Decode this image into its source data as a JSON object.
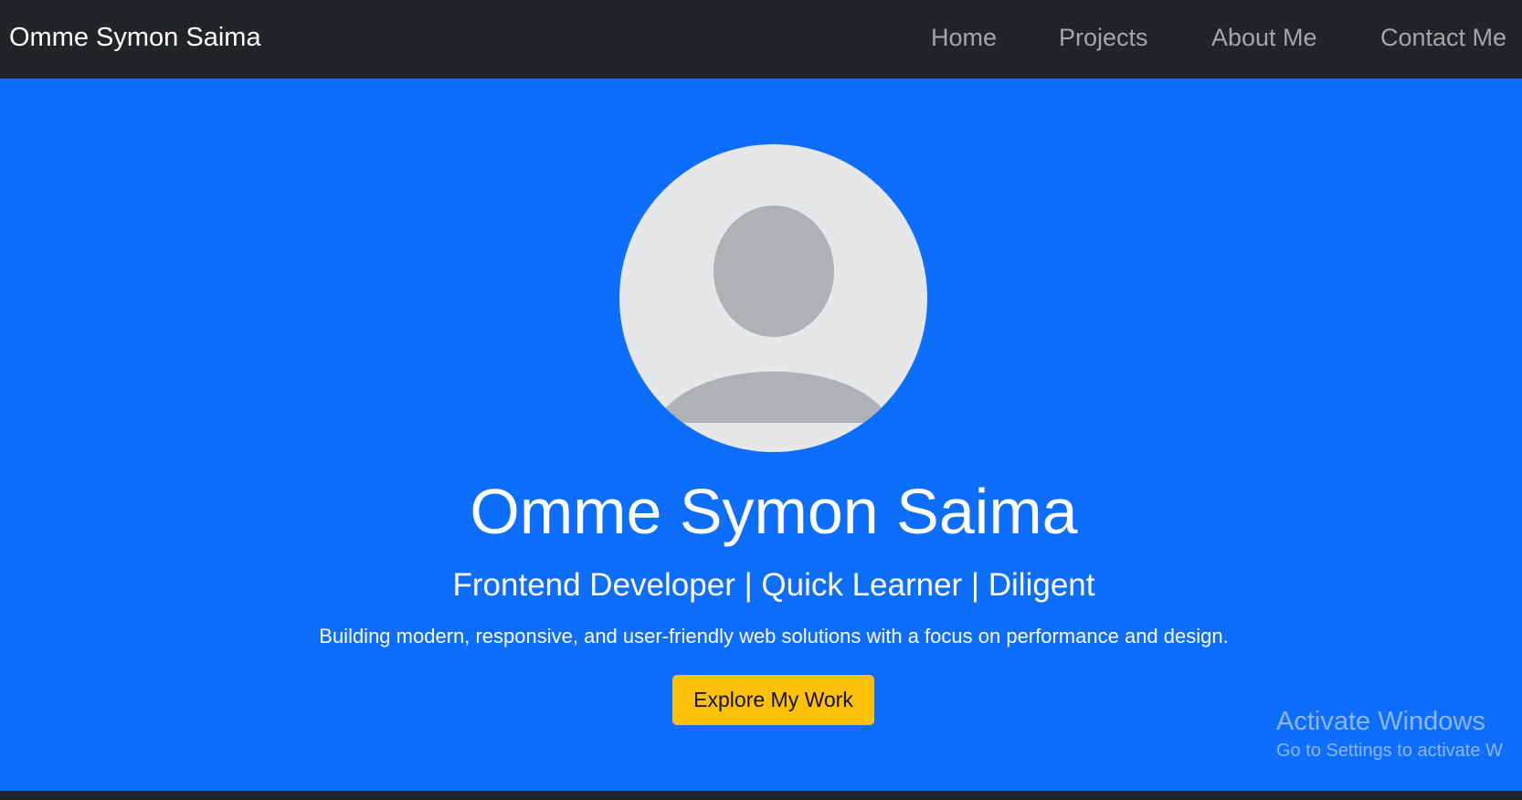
{
  "navbar": {
    "brand": "Omme Symon Saima",
    "links": [
      {
        "label": "Home"
      },
      {
        "label": "Projects"
      },
      {
        "label": "About Me"
      },
      {
        "label": "Contact Me"
      }
    ]
  },
  "hero": {
    "avatar_icon": "user-avatar-placeholder-icon",
    "name": "Omme Symon Saima",
    "tagline": "Frontend Developer | Quick Learner | Diligent",
    "description": "Building modern, responsive, and user-friendly web solutions with a focus on performance and design.",
    "cta_label": "Explore My Work"
  },
  "watermark": {
    "title": "Activate Windows",
    "subtitle": "Go to Settings to activate W"
  },
  "colors": {
    "navbar_bg": "#212529",
    "hero_bg": "#0d6efd",
    "cta_bg": "#ffc107",
    "nav_link": "#a3a7ab",
    "avatar_bg": "#e5e7e9",
    "avatar_fg": "#adb2b7"
  }
}
